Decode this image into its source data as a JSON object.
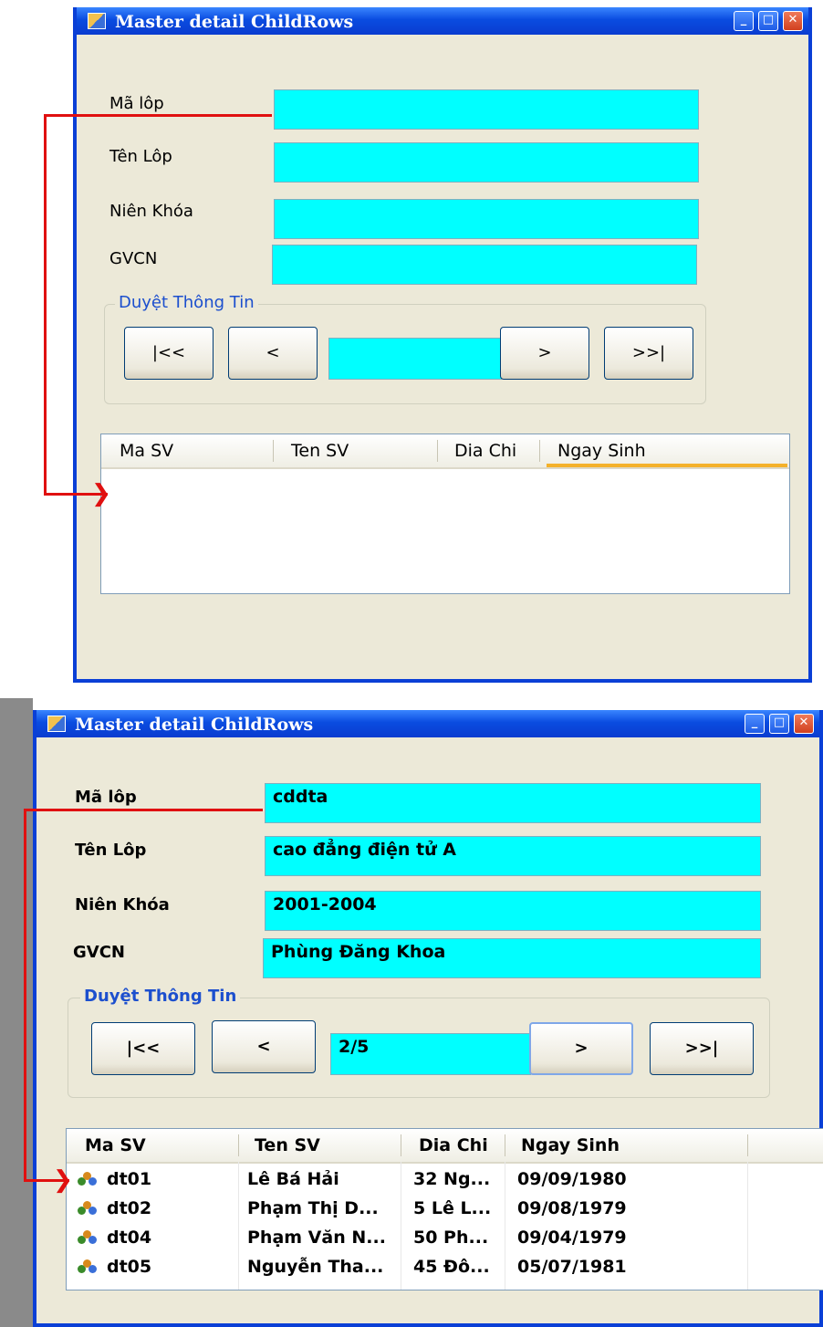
{
  "top_window": {
    "title": "Master detail ChildRows",
    "labels": {
      "ma_lop": "Mã lôp",
      "ten_lop": "Tên Lôp",
      "nien_khoa": "Niên Khóa",
      "gvcn": "GVCN"
    },
    "fields": {
      "ma_lop": "",
      "ten_lop": "",
      "nien_khoa": "",
      "gvcn": "",
      "position": ""
    },
    "group_title": "Duyệt Thông Tin",
    "buttons": {
      "first": "|<<",
      "prev": "<",
      "next": ">",
      "last": ">>|"
    },
    "grid_columns": [
      "Ma SV",
      "Ten SV",
      "Dia Chi",
      "Ngay Sinh"
    ]
  },
  "bottom_window": {
    "title": "Master detail ChildRows",
    "labels": {
      "ma_lop": "Mã lôp",
      "ten_lop": "Tên Lôp",
      "nien_khoa": "Niên Khóa",
      "gvcn": "GVCN"
    },
    "fields": {
      "ma_lop": "cddta",
      "ten_lop": "cao đẳng điện tử A",
      "nien_khoa": "2001-2004",
      "gvcn": "Phùng Đăng Khoa",
      "position": "2/5"
    },
    "group_title": "Duyệt Thông Tin",
    "buttons": {
      "first": "|<<",
      "prev": "<",
      "next": ">",
      "last": ">>|"
    },
    "grid_columns": [
      "Ma SV",
      "Ten SV",
      "Dia Chi",
      "Ngay Sinh"
    ],
    "grid_rows": [
      {
        "ma_sv": "dt01",
        "ten_sv": "Lê Bá Hải",
        "dia_chi": "32 Ng...",
        "ngay_sinh": "09/09/1980"
      },
      {
        "ma_sv": "dt02",
        "ten_sv": "Phạm Thị D...",
        "dia_chi": "5 Lê L...",
        "ngay_sinh": "09/08/1979"
      },
      {
        "ma_sv": "dt04",
        "ten_sv": "Phạm Văn N...",
        "dia_chi": "50 Ph...",
        "ngay_sinh": "09/04/1979"
      },
      {
        "ma_sv": "dt05",
        "ten_sv": "Nguyễn Tha...",
        "dia_chi": "45 Đô...",
        "ngay_sinh": "05/07/1981"
      }
    ]
  },
  "colors": {
    "textbox": "#00ffff",
    "titlebar": "#0a4ce0",
    "window_bg": "#ece9d8",
    "annotation_arrow": "#e01010",
    "group_title": "#1c4fce"
  },
  "icons": [
    "form-icon",
    "minimize-icon",
    "maximize-icon",
    "close-icon",
    "student-icon"
  ]
}
